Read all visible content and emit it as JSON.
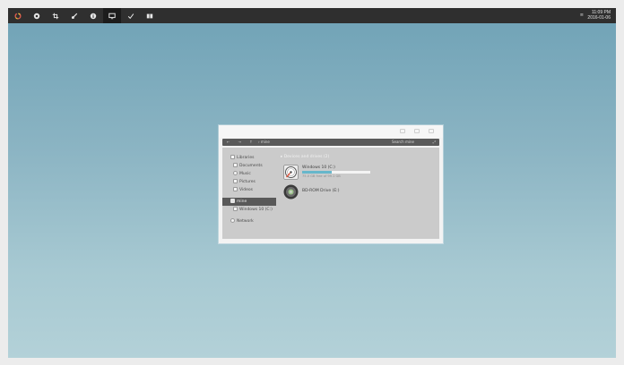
{
  "taskbar": {
    "icons": [
      {
        "name": "colorful-logo-icon"
      },
      {
        "name": "record-icon"
      },
      {
        "name": "crop-icon"
      },
      {
        "name": "brush-icon"
      },
      {
        "name": "info-icon"
      },
      {
        "name": "monitor-icon",
        "active": true
      },
      {
        "name": "checkmark-icon"
      },
      {
        "name": "film-icon"
      }
    ],
    "tray_icon": "≡",
    "time": "11:09 PM",
    "date": "2016-01-06"
  },
  "explorer": {
    "address": {
      "nav_glyphs": "← → ↑",
      "path": "› mine",
      "search_placeholder": "Search mine",
      "expand_glyph": "⤢"
    },
    "nav": {
      "libraries": "Libraries",
      "documents": "Documents",
      "music": "Music",
      "pictures": "Pictures",
      "videos": "Videos",
      "computer": "mine",
      "drive_c": "Windows 10 (C:)",
      "network": "Network"
    },
    "devices_header": "▸ Devices and drives (2)",
    "drives": [
      {
        "name": "Windows 10 (C:)",
        "space": "75.0 GB free of 99.1 GB",
        "used_fraction": 0.43
      },
      {
        "name": "BD-ROM Drive (E:)"
      }
    ],
    "accent": "#67b7cb"
  }
}
